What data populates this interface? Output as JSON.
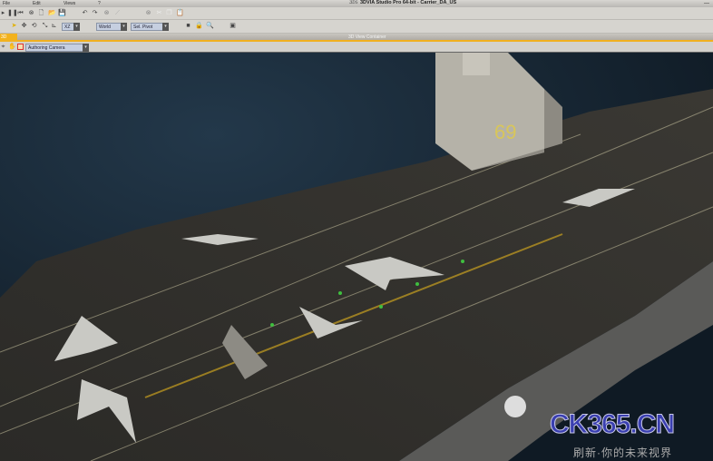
{
  "window": {
    "title": "3DVIA Studio Pro 64-bit - Carrier_DA_US",
    "minimize": "—"
  },
  "menu": [
    "File",
    "Edit",
    "Views",
    "?"
  ],
  "toolbar": {
    "axis_value": "XZ",
    "space_value": "World",
    "pivot_value": "Sel. Pivot"
  },
  "tabs": {
    "active": "3D View",
    "container_title": "3D View Container"
  },
  "camera": {
    "value": "Authoring Camera"
  },
  "scene": {
    "hull_number": "69"
  },
  "watermark": {
    "main": "CK365.CN",
    "sub": "刷新·你的未来视界"
  }
}
